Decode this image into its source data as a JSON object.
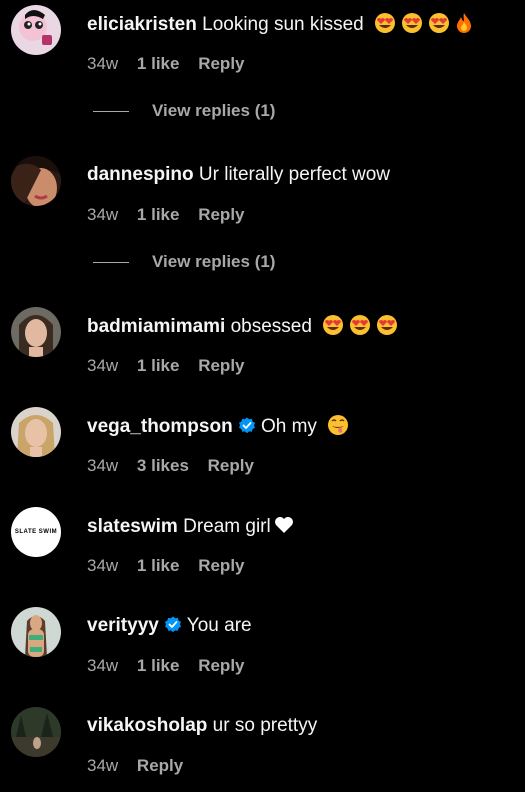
{
  "comments": [
    {
      "username": "eliciakristen",
      "text": "Looking sun kissed",
      "emojis": [
        "heart-eyes-emoji",
        "heart-eyes-emoji",
        "heart-eyes-emoji",
        "fire-emoji"
      ],
      "time": "34w",
      "likes": "1 like",
      "reply": "Reply",
      "view_replies": "View replies (1)"
    },
    {
      "username": "dannespino",
      "text": "Ur literally perfect wow",
      "time": "34w",
      "likes": "1 like",
      "reply": "Reply",
      "view_replies": "View replies (1)"
    },
    {
      "username": "badmiamimami",
      "text": "obsessed",
      "emojis": [
        "heart-eyes-emoji",
        "heart-eyes-emoji",
        "heart-eyes-emoji"
      ],
      "time": "34w",
      "likes": "1 like",
      "reply": "Reply"
    },
    {
      "username": "vega_thompson",
      "verified": true,
      "text": "Oh my",
      "emojis": [
        "tongue-out-emoji"
      ],
      "time": "34w",
      "likes": "3 likes",
      "reply": "Reply"
    },
    {
      "username": "slateswim",
      "avatar_text": "SLATE SWIM",
      "text": "Dream girl",
      "emojis": [
        "white-heart-emoji"
      ],
      "time": "34w",
      "likes": "1 like",
      "reply": "Reply"
    },
    {
      "username": "verityyy",
      "verified": true,
      "text": "You are",
      "time": "34w",
      "likes": "1 like",
      "reply": "Reply"
    },
    {
      "username": "vikakosholap",
      "text": "ur so prettyy",
      "time": "34w",
      "reply": "Reply"
    }
  ],
  "colors": {
    "background": "#000000",
    "primary_text": "#f5f5f5",
    "secondary_text": "#a8a8a8",
    "verified_blue": "#0095f6"
  }
}
